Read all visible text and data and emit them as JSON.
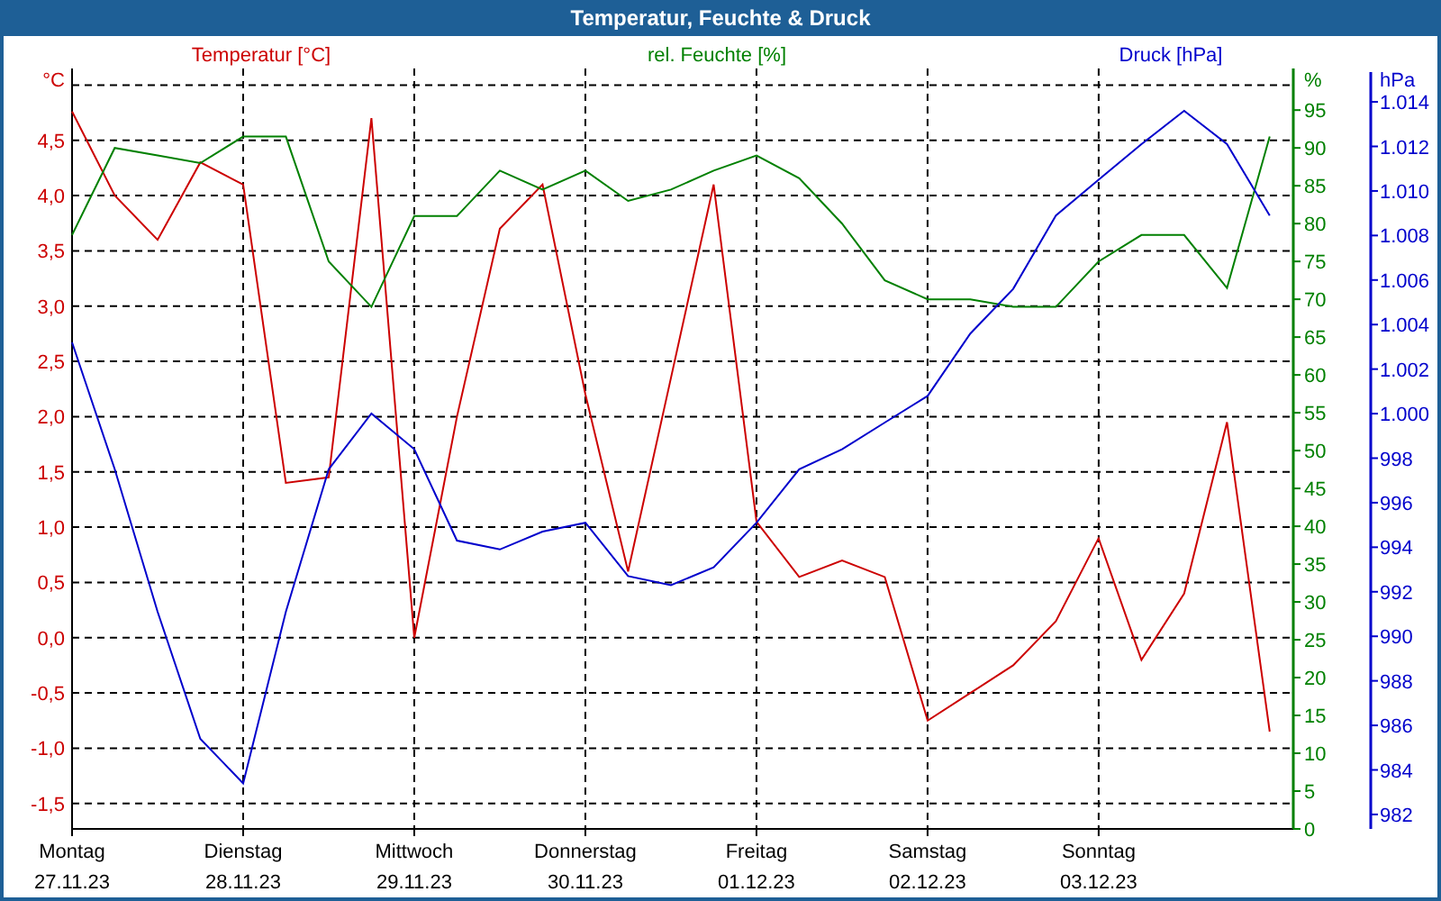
{
  "window": {
    "title": "Temperatur, Feuchte & Druck"
  },
  "temperature": {
    "chart_data": {
      "type": "line",
      "grid": true,
      "ylabel": "°C",
      "ylim": [
        -1.73,
        5.15
      ],
      "categories": [
        "Montag",
        null,
        null,
        null,
        "Dienstag",
        null,
        null,
        null,
        "Mittwoch",
        null,
        null,
        null,
        "Donnerstag",
        null,
        null,
        null,
        "Freitag",
        null,
        null,
        null,
        "Samstag",
        null,
        null,
        null,
        "Sonntag",
        null,
        null,
        null,
        null
      ],
      "yticks": [
        {
          "value": 4.5,
          "label": "4,5"
        },
        {
          "value": 4,
          "label": "4,0"
        },
        {
          "value": 3.5,
          "label": "3,5"
        },
        {
          "value": 3,
          "label": "3,0"
        },
        {
          "value": 2.5,
          "label": "2,5"
        },
        {
          "value": 2,
          "label": "2,0"
        },
        {
          "value": 1.5,
          "label": "1,5"
        },
        {
          "value": 1,
          "label": "1,0"
        },
        {
          "value": 0.5,
          "label": "0,5"
        },
        {
          "value": 0,
          "label": "0,0"
        },
        {
          "value": -0.5,
          "label": "-0,5"
        },
        {
          "value": -1,
          "label": "-1,0"
        },
        {
          "value": -1.5,
          "label": "-1,5"
        }
      ],
      "series": [
        {
          "name": "Temperatur [°C]",
          "color": "#cc0000",
          "values": [
            4.76,
            4.0,
            3.6,
            4.3,
            4.1,
            1.4,
            1.45,
            4.7,
            0.0,
            2.0,
            3.7,
            4.1,
            2.2,
            0.6,
            2.35,
            4.1,
            1.05,
            0.55,
            0.7,
            0.55,
            -0.75,
            -0.5,
            -0.25,
            0.15,
            0.9,
            -0.2,
            0.4,
            1.95,
            -0.85
          ]
        }
      ]
    },
    "dates": [
      "27.11.23",
      "28.11.23",
      "29.11.23",
      "30.11.23",
      "01.12.23",
      "02.12.23",
      "03.12.23"
    ]
  },
  "humidity": {
    "chart_data": {
      "type": "line",
      "ylabel": "%",
      "ylim": [
        0,
        100.5
      ],
      "yticks": [
        95,
        90,
        85,
        80,
        75,
        70,
        65,
        60,
        55,
        50,
        45,
        40,
        35,
        30,
        25,
        20,
        15,
        10,
        5,
        0
      ],
      "series": [
        {
          "name": "rel. Feuchte [%]",
          "color": "#008000",
          "values": [
            78.5,
            90,
            89,
            88,
            91.5,
            91.5,
            75,
            69,
            81,
            81,
            87,
            84.5,
            87,
            83,
            84.5,
            87,
            89,
            86,
            80,
            72.5,
            70,
            70,
            69,
            69,
            75,
            78.5,
            78.5,
            71.5,
            91.5
          ]
        }
      ]
    }
  },
  "pressure": {
    "chart_data": {
      "type": "line",
      "ylabel": "hPa",
      "ylim": [
        981.35,
        1015.5
      ],
      "yticks": [
        {
          "value": 1014,
          "label": "1.014"
        },
        {
          "value": 1012,
          "label": "1.012"
        },
        {
          "value": 1010,
          "label": "1.010"
        },
        {
          "value": 1008,
          "label": "1.008"
        },
        {
          "value": 1006,
          "label": "1.006"
        },
        {
          "value": 1004,
          "label": "1.004"
        },
        {
          "value": 1002,
          "label": "1.002"
        },
        {
          "value": 1000,
          "label": "1.000"
        },
        998,
        996,
        994,
        992,
        990,
        988,
        986,
        984,
        982
      ],
      "series": [
        {
          "name": "Druck [hPa]",
          "color": "#0000cc",
          "values": [
            1003.2,
            997.5,
            991.1,
            985.4,
            983.4,
            991.1,
            997.5,
            1000.0,
            998.4,
            994.3,
            993.9,
            994.7,
            995.1,
            992.7,
            992.3,
            993.1,
            995.1,
            997.5,
            998.4,
            999.6,
            1000.8,
            1003.6,
            1005.6,
            1008.9,
            1010.5,
            1012.1,
            1013.6,
            1012.1,
            1008.9
          ]
        }
      ]
    }
  }
}
